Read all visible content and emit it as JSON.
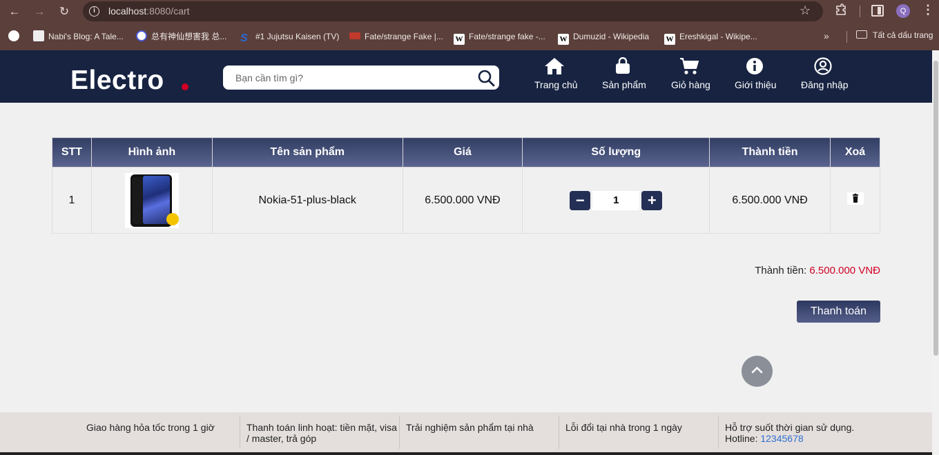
{
  "browser": {
    "url_host": "localhost",
    "url_rest": ":8080/cart",
    "profile_initial": "Q",
    "bookmarks": [
      {
        "label": "Nabi's Blog: A Tale..."
      },
      {
        "label": "总有神仙想害我 总..."
      },
      {
        "label": "#1 Jujutsu Kaisen (TV)"
      },
      {
        "label": "Fate/strange Fake |..."
      },
      {
        "label": "Fate/strange fake -..."
      },
      {
        "label": "Dumuzid - Wikipedia"
      },
      {
        "label": "Ereshkigal - Wikipe..."
      }
    ],
    "all_bookmarks_label": "Tất cả dấu trang"
  },
  "site": {
    "logo": "Electro",
    "search_placeholder": "Bạn cần tìm gì?",
    "nav": [
      {
        "label": "Trang chủ",
        "icon": "home-icon"
      },
      {
        "label": "Sản phẩm",
        "icon": "shopping-bag-icon"
      },
      {
        "label": "Giỏ hàng",
        "icon": "cart-icon"
      },
      {
        "label": "Giới thiệu",
        "icon": "info-icon"
      },
      {
        "label": "Đăng nhập",
        "icon": "user-circle-icon"
      }
    ]
  },
  "cart": {
    "headers": [
      "STT",
      "Hình ảnh",
      "Tên sản phẩm",
      "Giá",
      "Số lượng",
      "Thành tiền",
      "Xoá"
    ],
    "rows": [
      {
        "stt": "1",
        "name": "Nokia-51-plus-black",
        "price": "6.500.000 VNĐ",
        "qty": "1",
        "subtotal": "6.500.000 VNĐ"
      }
    ],
    "total_label": "Thành tiền:",
    "total_value": "6.500.000 VNĐ",
    "checkout_label": "Thanh toán"
  },
  "footer": {
    "items": [
      {
        "text": "Giao hàng hỏa tốc trong 1 giờ"
      },
      {
        "text": "Thanh toán linh hoạt: tiền mặt, visa / master, trả góp"
      },
      {
        "text": "Trải nghiệm sản phẩm tại nhà"
      },
      {
        "text": "Lỗi đổi tại nhà trong 1 ngày"
      },
      {
        "text": "Hỗ trợ suốt thời gian sử dụng.",
        "hotline_label": "Hotline:",
        "hotline": "12345678"
      }
    ]
  },
  "colors": {
    "header_bg": "#172341",
    "accent_red": "#d10024",
    "browser_chrome": "#5a3f3b"
  }
}
